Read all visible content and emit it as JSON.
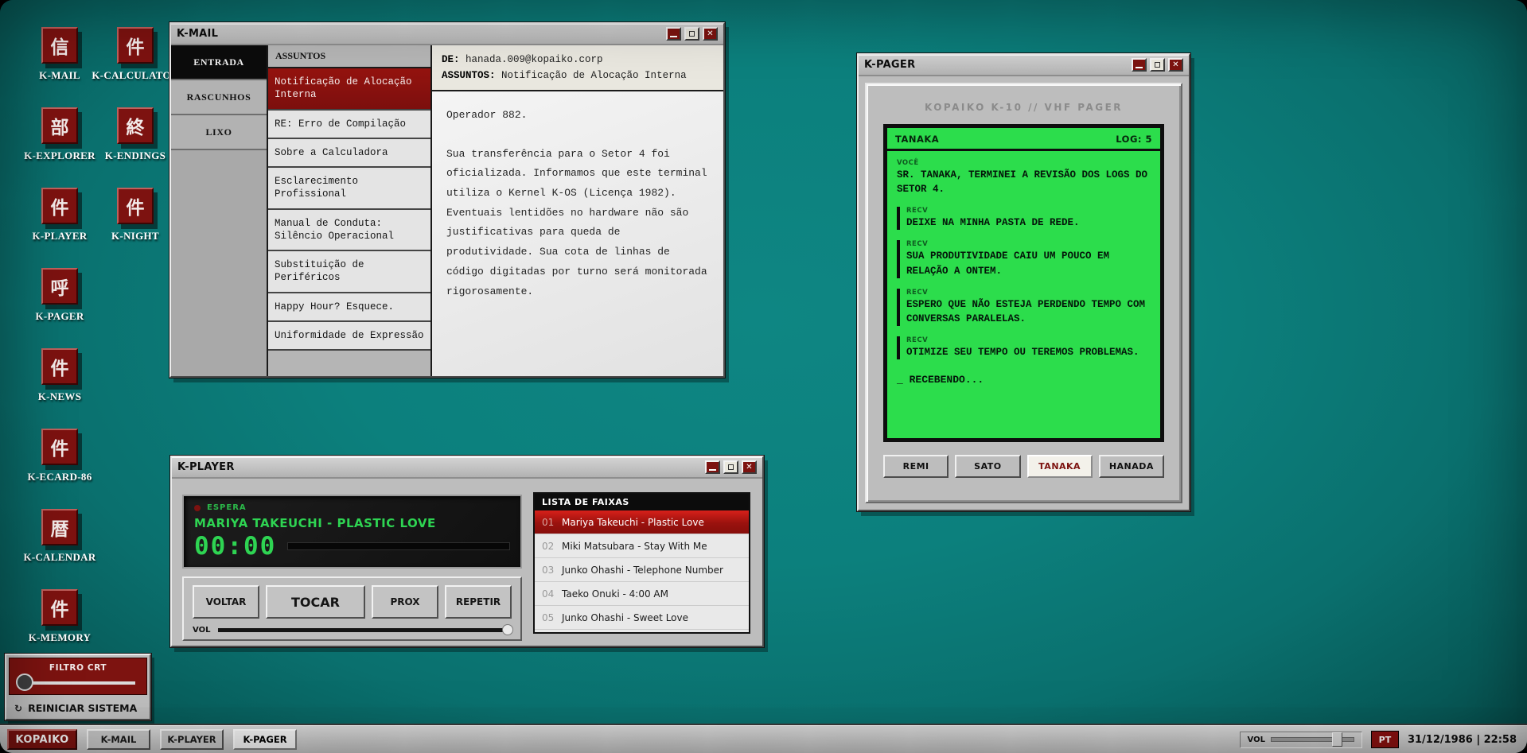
{
  "chrome": {
    "close_glyph": "✕"
  },
  "desktop": {
    "icons": [
      {
        "label": "K-MAIL",
        "glyph": "信"
      },
      {
        "label": "K-CALCULATOR",
        "glyph": "件"
      },
      {
        "label": "K-EXPLORER",
        "glyph": "部"
      },
      {
        "label": "K-ENDINGS",
        "glyph": "終"
      },
      {
        "label": "K-PLAYER",
        "glyph": "件"
      },
      {
        "label": "K-NIGHT",
        "glyph": "件"
      },
      {
        "label": "K-PAGER",
        "glyph": "呼"
      },
      {
        "label": "K-NEWS",
        "glyph": "件"
      },
      {
        "label": "K-ECARD-86",
        "glyph": "件"
      },
      {
        "label": "K-CALENDAR",
        "glyph": "暦"
      },
      {
        "label": "K-MEMORY",
        "glyph": "件"
      }
    ]
  },
  "kmail": {
    "title": "K-MAIL",
    "folders": [
      {
        "label": "ENTRADA"
      },
      {
        "label": "RASCUNHOS"
      },
      {
        "label": "LIXO"
      }
    ],
    "subjects_header": "ASSUNTOS",
    "subjects": [
      {
        "text": "Notificação de Alocação Interna"
      },
      {
        "text": "RE: Erro de Compilação"
      },
      {
        "text": "Sobre a Calculadora"
      },
      {
        "text": "Esclarecimento Profissional"
      },
      {
        "text": "Manual de Conduta: Silêncio Operacional"
      },
      {
        "text": "Substituição de Periféricos"
      },
      {
        "text": "Happy Hour? Esquece."
      },
      {
        "text": "Uniformidade de Expressão"
      }
    ],
    "reader": {
      "from_label": "DE:",
      "from": "hanada.009@kopaiko.corp",
      "subject_label": "ASSUNTOS:",
      "subject": "Notificação de Alocação Interna",
      "body": [
        "Operador 882.",
        "Sua transferência para o Setor 4 foi oficializada. Informamos que este terminal utiliza o Kernel K-OS (Licença 1982). Eventuais lentidões no hardware não são justificativas para queda de produtividade. Sua cota de linhas de código digitadas por turno será monitorada rigorosamente."
      ]
    }
  },
  "kpager": {
    "title": "K-PAGER",
    "device_header": "KOPAIKO K-10 // VHF PAGER",
    "contact": "TANAKA",
    "log": "LOG: 5",
    "messages": [
      {
        "tag": "VOCÊ",
        "text": "SR. TANAKA, TERMINEI A REVISÃO DOS LOGS DO SETOR 4."
      },
      {
        "tag": "RECV",
        "text": "DEIXE NA MINHA PASTA DE REDE."
      },
      {
        "tag": "RECV",
        "text": "SUA PRODUTIVIDADE CAIU UM POUCO EM RELAÇÃO A ONTEM."
      },
      {
        "tag": "RECV",
        "text": "ESPERO QUE NÃO ESTEJA PERDENDO TEMPO COM CONVERSAS PARALELAS."
      },
      {
        "tag": "RECV",
        "text": "OTIMIZE SEU TEMPO OU TEREMOS PROBLEMAS."
      }
    ],
    "receiving": "_ RECEBENDO...",
    "contacts": [
      {
        "label": "REMI"
      },
      {
        "label": "SATO"
      },
      {
        "label": "TANAKA"
      },
      {
        "label": "HANADA"
      }
    ]
  },
  "kplayer": {
    "title": "K-PLAYER",
    "status": "ESPERA",
    "now_playing": "MARIYA TAKEUCHI - PLASTIC LOVE",
    "time": "00:00",
    "buttons": {
      "back": "VOLTAR",
      "play": "TOCAR",
      "next": "PROX",
      "repeat": "REPETIR"
    },
    "vol_label": "VOL",
    "list_header": "LISTA DE FAIXAS",
    "tracks": [
      {
        "num": "01",
        "title": "Mariya Takeuchi - Plastic Love"
      },
      {
        "num": "02",
        "title": "Miki Matsubara - Stay With Me"
      },
      {
        "num": "03",
        "title": "Junko Ohashi - Telephone Number"
      },
      {
        "num": "04",
        "title": "Taeko Onuki - 4:00 AM"
      },
      {
        "num": "05",
        "title": "Junko Ohashi - Sweet Love"
      }
    ]
  },
  "crt_panel": {
    "title": "FILTRO CRT",
    "restart_icon": "↻",
    "restart_label": "REINICIAR SISTEMA"
  },
  "taskbar": {
    "start": "KOPAIKO",
    "tasks": [
      {
        "label": "K-MAIL"
      },
      {
        "label": "K-PLAYER"
      },
      {
        "label": "K-PAGER"
      }
    ],
    "vol_label": "VOL",
    "lang": "PT",
    "clock": "31/12/1986 | 22:58"
  },
  "colors": {
    "desktop_teal": "#0c807d",
    "accent_red": "#7d1310",
    "pager_green": "#2cdd4c",
    "player_green": "#2ed452",
    "window_gray": "#bdbdbd"
  }
}
